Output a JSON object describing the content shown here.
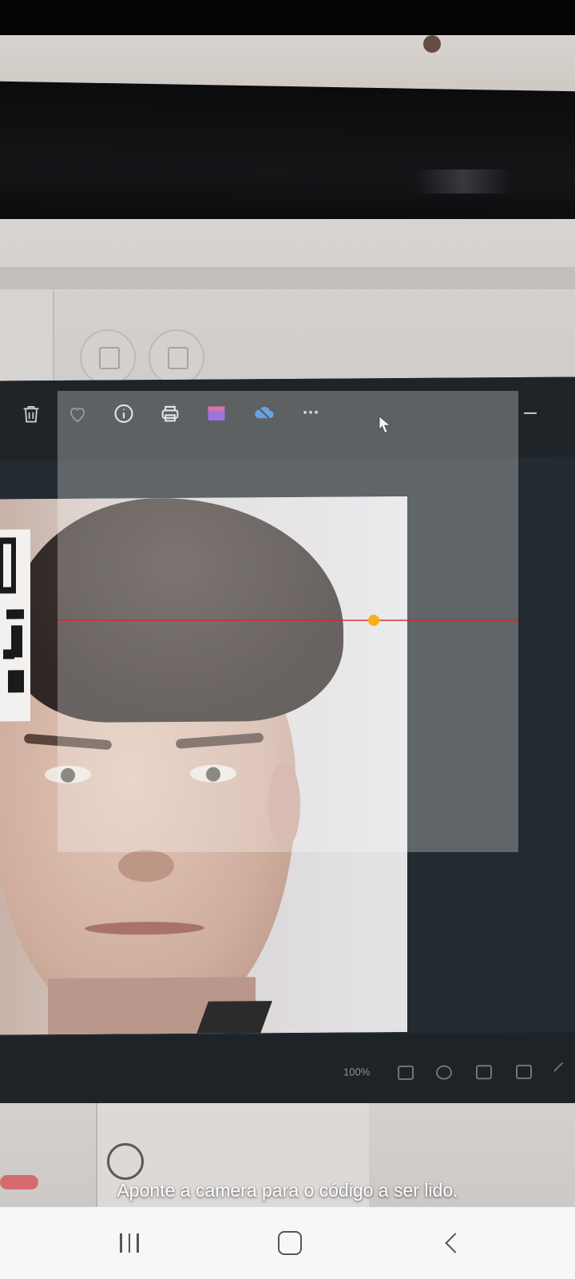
{
  "scanner": {
    "instruction": "Aponte a camera para o código a ser lido."
  },
  "viewer": {
    "toolbar_icons": [
      "trash-icon",
      "heart-icon",
      "info-icon",
      "print-icon",
      "video-editor-icon",
      "onedrive-icon",
      "more-icon",
      "mouse-pointer-icon"
    ],
    "zoom_level": "100%"
  },
  "nav": {
    "recent_apps": "recent-apps-icon",
    "home": "home-icon",
    "back": "back-icon"
  },
  "colors": {
    "scan_dot": "#f4b11a",
    "scan_line": "#dc2828",
    "nav_background": "#f7f7f7",
    "viewer_background": "#232a30"
  }
}
